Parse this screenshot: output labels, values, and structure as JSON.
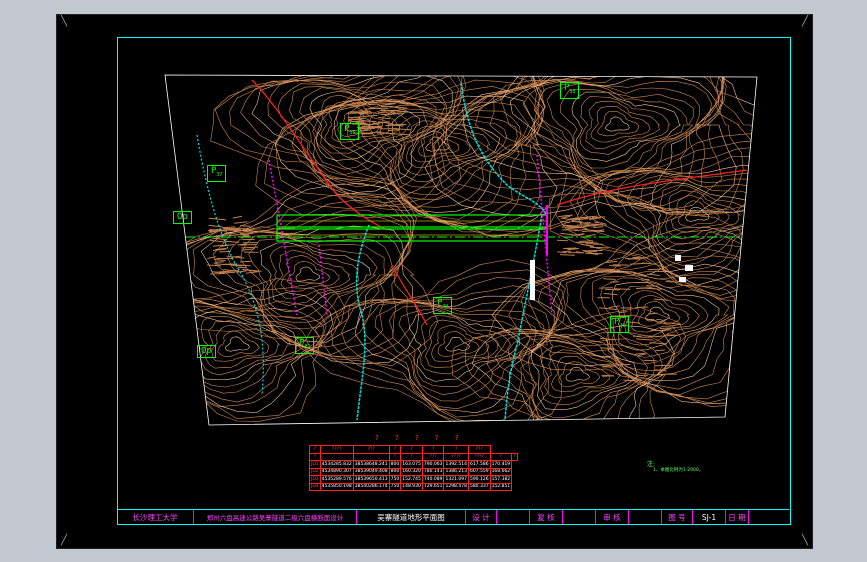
{
  "colors": {
    "background": "#c3c8d0",
    "canvas": "#000000",
    "frame": "#00ffff",
    "contour": "#e8a060",
    "road": "#00ff00",
    "river": "#00ffff",
    "tunnel": "#ff00ff",
    "redline": "#ff2020",
    "title_text": "#ff44ff"
  },
  "map_labels": [
    {
      "text": "P",
      "sub": "38",
      "id": "p38"
    },
    {
      "text": "P",
      "sub": "36",
      "id": "p36"
    },
    {
      "text": "P",
      "sub": "37",
      "id": "p37"
    },
    {
      "text": "Op",
      "sub": "",
      "id": "op-left"
    },
    {
      "text": "P",
      "sub": "39",
      "id": "p39"
    },
    {
      "text": "P",
      "sub": "40",
      "id": "p40"
    },
    {
      "text": "P",
      "sub": "32",
      "id": "p32"
    },
    {
      "text": "Op",
      "sub": "",
      "id": "op-bottom"
    }
  ],
  "table": {
    "title": "? ? ? ? ?",
    "header_row1": [
      "?",
      "????",
      "???",
      "?",
      "?",
      "?",
      "?",
      "???"
    ],
    "header_row2": [
      "?",
      "",
      "",
      "?",
      "?",
      "???",
      "????",
      "????",
      "?",
      "?"
    ],
    "rows": [
      [
        "JD1",
        "4534285.832",
        "38538648.241",
        "800",
        "163.075",
        "790.063",
        "1392.514",
        "617.586",
        "170.419"
      ],
      [
        "JD2",
        "4534890.307",
        "38539049.408",
        "800",
        "160.320",
        "780.143",
        "1386.213",
        "607.559",
        "168.662"
      ],
      [
        "JD3",
        "4535289.576",
        "38539650.413",
        "750",
        "152.745",
        "740.089",
        "1321.097",
        "590.126",
        "157.382"
      ],
      [
        "JD4",
        "4535850.198",
        "38540286.174",
        "750",
        "148.930",
        "729.651",
        "1298.478",
        "580.337",
        "152.851"
      ]
    ]
  },
  "note": {
    "title": "注:",
    "line": "1、本图比例为1:2000。"
  },
  "title_block": {
    "school": "长沙理工大学",
    "project": "郑州六盘高速公路吴寨隧道二级六盘横断面设计",
    "drawing": "吴寨隧道地形平面图",
    "design": "设 计",
    "review": "复 核",
    "approve": "审 核",
    "drawing_no_label": "图 号",
    "drawing_no": "SJ-1",
    "date_label": "日 期"
  }
}
